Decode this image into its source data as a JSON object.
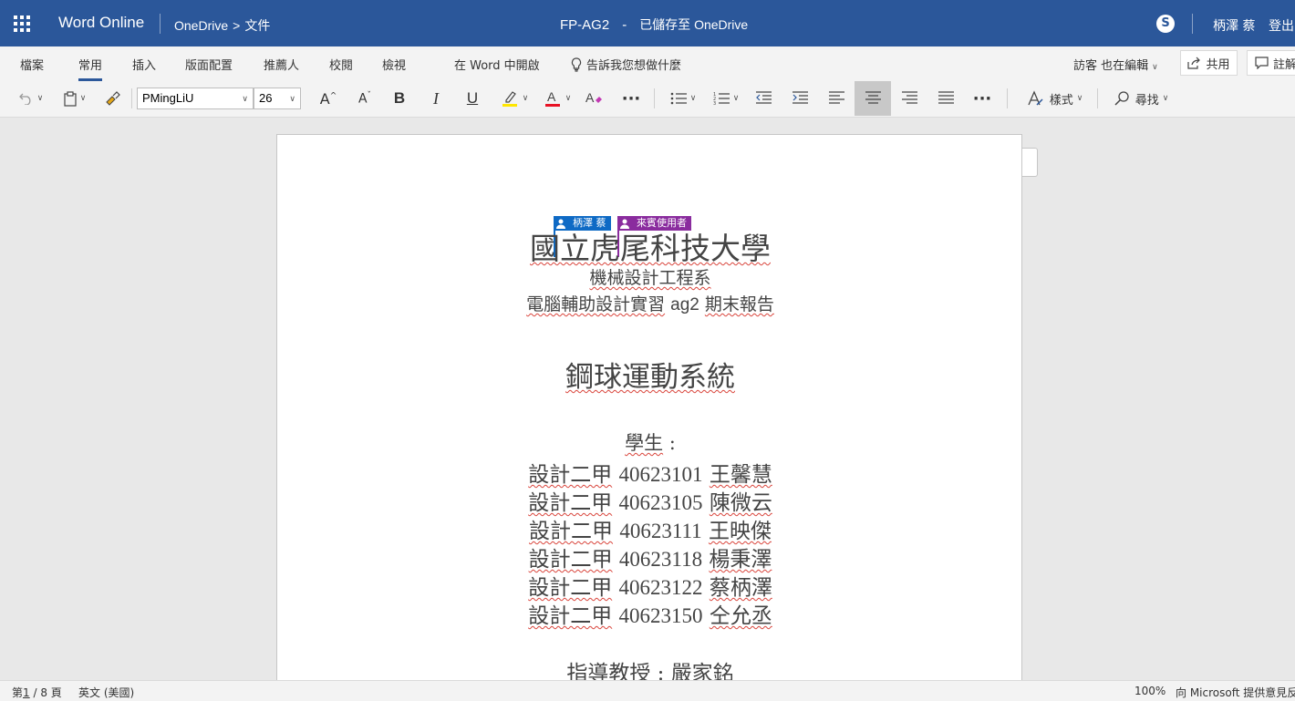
{
  "header": {
    "app_name": "Word Online",
    "breadcrumb_root": "OneDrive",
    "breadcrumb_sep": ">",
    "breadcrumb_folder": "文件",
    "doc_name": "FP-AG2",
    "title_sep": "-",
    "save_status": "已儲存至 OneDrive",
    "skype_glyph": "S",
    "user_name": "柄澤 蔡",
    "sign_out": "登出"
  },
  "ribbon": {
    "tabs": [
      "檔案",
      "常用",
      "插入",
      "版面配置",
      "推薦人",
      "校閱",
      "檢視"
    ],
    "active_tab": "常用",
    "open_in_word": "在 Word 中開啟",
    "tell_me": "告訴我您想做什麼",
    "guest_editing": "訪客 也在編輯",
    "share": "共用",
    "comments": "註解"
  },
  "toolbar": {
    "font_name": "PMingLiU",
    "font_size": "26",
    "bold": "B",
    "italic": "I",
    "underline": "U",
    "more": "···",
    "styles": "樣式",
    "find": "尋找",
    "highlight_color": "#ffe600",
    "font_color": "#e81123"
  },
  "document": {
    "presence": [
      {
        "name": "柄澤 蔡",
        "color": "#0e6ac5"
      },
      {
        "name": "來賓使用者",
        "color": "#8a2c9e"
      }
    ],
    "university": "國立虎尾科技大學",
    "department": "機械設計工程系",
    "course_prefix": "電腦輔助設計實習",
    "course_code": "ag2",
    "course_suffix": "期末報告",
    "project_title": "鋼球運動系統",
    "students_label": "學生",
    "students_colon": ":",
    "students": [
      {
        "class": "設計二甲",
        "id": "40623101",
        "name": "王馨慧"
      },
      {
        "class": "設計二甲",
        "id": "40623105",
        "name": "陳微云"
      },
      {
        "class": "設計二甲",
        "id": "40623111",
        "name": "王映傑"
      },
      {
        "class": "設計二甲",
        "id": "40623118",
        "name": "楊秉澤"
      },
      {
        "class": "設計二甲",
        "id": "40623122",
        "name": "蔡柄澤"
      },
      {
        "class": "設計二甲",
        "id": "40623150",
        "name": "仝允丞"
      }
    ],
    "advisor": "指導教授 : 嚴家銘"
  },
  "statusbar": {
    "page_prefix": "第",
    "page_current": "1",
    "page_rest": " / 8 頁",
    "language": "英文 (美國)",
    "zoom": "100%",
    "feedback": "向 Microsoft 提供意見反應"
  }
}
